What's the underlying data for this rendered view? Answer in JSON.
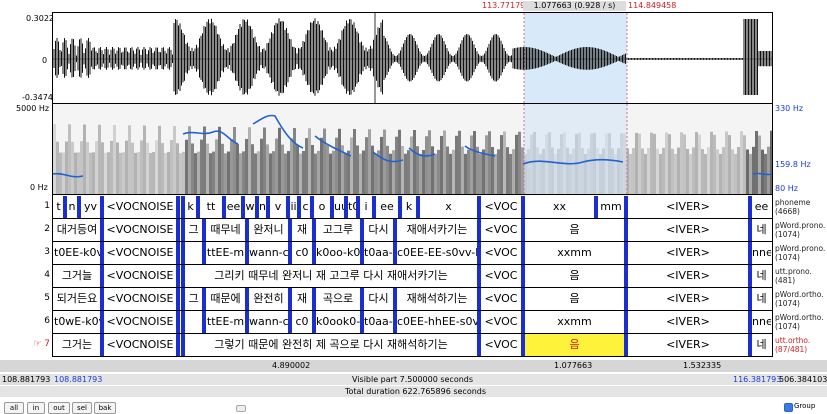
{
  "header": {
    "left_time": "113.771796",
    "sel_dur": "1.077663 (0.928 / s)",
    "right_time": "114.849458"
  },
  "wave": {
    "ymax": "0.3022",
    "zero": "0",
    "ymin": "-0.3474"
  },
  "spec": {
    "fmax": "5000 Hz",
    "fmin": "0 Hz",
    "pmax": "330 Hz",
    "pmid": "159.8 Hz",
    "pmin": "80 Hz"
  },
  "tiers": [
    {
      "num": "1",
      "name1": "phoneme",
      "name2": "(4668)"
    },
    {
      "num": "2",
      "name1": "pWord.prono.",
      "name2": "(1074)"
    },
    {
      "num": "3",
      "name1": "pWord.prono.",
      "name2": "(1074)"
    },
    {
      "num": "4",
      "name1": "utt.prono.",
      "name2": "(481)"
    },
    {
      "num": "5",
      "name1": "pWord.ortho.",
      "name2": "(1074)"
    },
    {
      "num": "6",
      "name1": "pWord.ortho.",
      "name2": "(1074)"
    },
    {
      "num": "☞ 7",
      "name1": "utt.ortho.",
      "name2": "(87/481)"
    }
  ],
  "t1": [
    "t",
    "n",
    "yv",
    "<VOCNOISE",
    "k",
    "tt",
    "ee",
    "w",
    "n",
    "v",
    "ii",
    "c",
    "o",
    "uu",
    "t0",
    "i",
    "ee",
    "k",
    "x",
    "<VOC",
    "xx",
    "mm",
    "<IVER>",
    "ee"
  ],
  "t2": [
    "대거등여",
    "<VOCNOISE",
    "그",
    "때무네",
    "완저니",
    "재",
    "고그루",
    "다시",
    "재애서카기는",
    "<VOC",
    "음",
    "<IVER>",
    "네"
  ],
  "t3": [
    "t0EE-k0v",
    "<VOCNOISE",
    "k0x",
    "ttEE-m",
    "wann-c0v",
    "c0",
    "k0oo-k0x",
    "t0aa-s",
    "c0EE-EE-s0vv-k",
    "<VOC",
    "xxmm",
    "<IVER>",
    "nne"
  ],
  "t4": [
    "그거늘",
    "<VOCNOISE",
    "그리키 때무네 완저니 재 고그루 다시 재애서카기는",
    "<VOC",
    "음",
    "<IVER>",
    "네"
  ],
  "t5": [
    "되거든요",
    "<VOCNOISE",
    "그",
    "때문에",
    "완전히",
    "재",
    "곡으로",
    "다시",
    "재해석하기는",
    "<VOC",
    "음",
    "<IVER>",
    "네"
  ],
  "t6": [
    "t0wE-k0v",
    "<VOCNOISE",
    "k0x",
    "ttEE-m",
    "wann-c0v",
    "c0",
    "k0ook0-x",
    "t0aa-s",
    "c0EE-hhEE-s0vv",
    "<VOC",
    "xxmm",
    "<IVER>",
    "nne"
  ],
  "t7": [
    "그거는",
    "<VOCNOISE",
    "그렇기 때문에 완전히 제 곡으로 다시 재해석하기는",
    "<VOC",
    "음",
    "<IVER>",
    "네"
  ],
  "footer": {
    "left_outer": "108.881793",
    "left_inner": "108.881793",
    "d1": "4.890002",
    "d2": "1.077663",
    "d3": "1.532335",
    "right_inner": "116.381793",
    "right_outer": "506.384103",
    "visible": "Visible part 7.500000 seconds",
    "total": "Total duration 622.765896 seconds"
  },
  "buttons": {
    "all": "all",
    "in": "in",
    "out": "out",
    "sel": "sel",
    "bak": "bak",
    "group": "Group"
  },
  "group_checked": true
}
